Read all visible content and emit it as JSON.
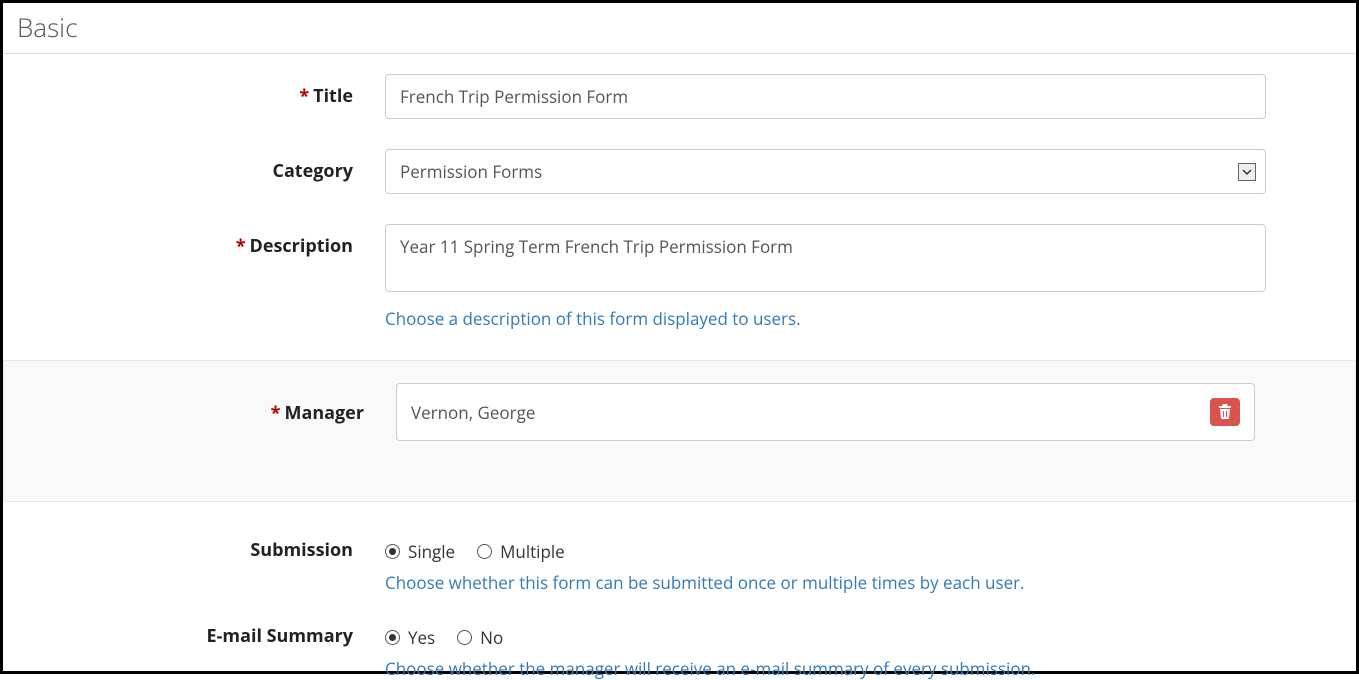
{
  "section": {
    "title": "Basic"
  },
  "fields": {
    "title": {
      "label": "Title",
      "required": true,
      "value": "French Trip Permission Form"
    },
    "category": {
      "label": "Category",
      "required": false,
      "value": "Permission Forms"
    },
    "description": {
      "label": "Description",
      "required": true,
      "value": "Year 11 Spring Term French Trip Permission Form",
      "help": "Choose a description of this form displayed to users."
    },
    "manager": {
      "label": "Manager",
      "required": true,
      "value": "Vernon, George"
    },
    "submission": {
      "label": "Submission",
      "options": {
        "single": "Single",
        "multiple": "Multiple"
      },
      "selected": "single",
      "help": "Choose whether this form can be submitted once or multiple times by each user."
    },
    "emailSummary": {
      "label": "E-mail Summary",
      "options": {
        "yes": "Yes",
        "no": "No"
      },
      "selected": "yes",
      "help": "Choose whether the manager will receive an e-mail summary of every submission."
    }
  },
  "asterisk": "*"
}
